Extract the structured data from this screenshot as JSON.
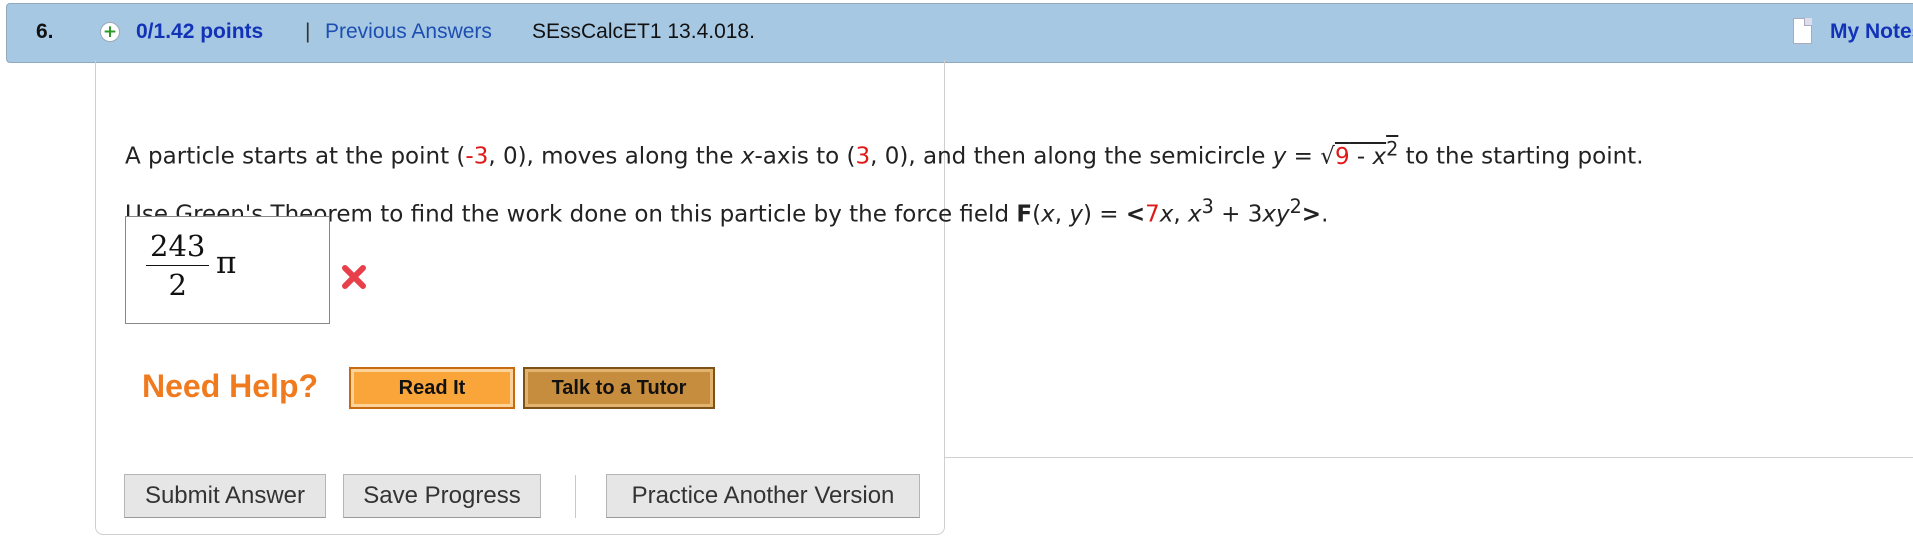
{
  "header": {
    "question_number": "6.",
    "points": "0/1.42 points",
    "separator": "|",
    "previous_answers": "Previous Answers",
    "problem_code": "SEssCalcET1 13.4.018.",
    "my_notes": "My Notes"
  },
  "question": {
    "line1": {
      "t1": "A particle starts at the point (",
      "v1": "-3",
      "t2": ", 0), moves along the ",
      "x": "x",
      "t3": "-axis to (",
      "v2": "3",
      "t4": ", 0), and then along the semicircle ",
      "y": "y",
      "t5": " = √",
      "v3": "9",
      "t6": " - ",
      "x2": "x",
      "sup2": "2",
      "t7": " to the starting point."
    },
    "line2": {
      "t1": "Use Green's Theorem to find the work done on this particle by the force field ",
      "F": "F",
      "t2": "(",
      "x": "x",
      "t3": ", ",
      "y": "y",
      "t4": ") = ",
      "lt": "<",
      "v1": "7",
      "x2": "x",
      "t5": ", ",
      "x3": "x",
      "sup3": "3",
      "t6": " + 3",
      "xy": "xy",
      "sup2": "2",
      "gt": ">",
      "t7": "."
    }
  },
  "answer": {
    "numerator": "243",
    "denominator": "2",
    "symbol": "π",
    "status": "incorrect"
  },
  "help": {
    "label": "Need Help?",
    "read_it": "Read It",
    "talk_to_tutor": "Talk to a Tutor"
  },
  "actions": {
    "submit": "Submit Answer",
    "save": "Save Progress",
    "practice": "Practice Another Version"
  },
  "colors": {
    "header_bg": "#a7c8e2",
    "points": "#1233b8",
    "link": "#1d4fb3",
    "highlight": "#e01818",
    "help": "#f07a1e",
    "read_it_bg": "#f9a53a",
    "tutor_bg": "#c78d3e"
  }
}
